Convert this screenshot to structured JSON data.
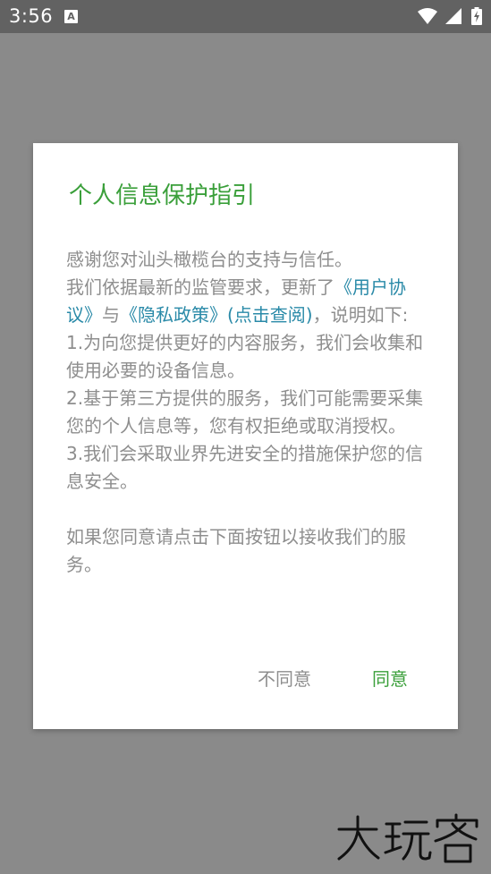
{
  "status_bar": {
    "time": "3:56",
    "icons": [
      "keyboard-a-icon",
      "wifi-icon",
      "signal-icon",
      "battery-charging-icon"
    ]
  },
  "dialog": {
    "title": "个人信息保护指引",
    "intro": "感谢您对汕头橄榄台的支持与信任。",
    "update_prefix": "我们依据最新的监管要求，更新了",
    "user_agreement": "《用户协议》",
    "and_text": "与",
    "privacy_policy": "《隐私政策》",
    "view_link": "(点击查阅)",
    "update_suffix": "，说明如下:",
    "item1": "1.为向您提供更好的内容服务，我们会收集和使用必要的设备信息。",
    "item2": "2.基于第三方提供的服务，我们可能需要采集您的个人信息等，您有权拒绝或取消授权。",
    "item3": "3.我们会采取业界先进安全的措施保护您的信息安全。",
    "closing": "如果您同意请点击下面按钮以接收我们的服务。",
    "disagree_label": "不同意",
    "agree_label": "同意"
  },
  "colors": {
    "accent_green": "#3a9f3a",
    "link_blue": "#2a8aa8",
    "body_gray": "#8e8e8e",
    "overlay": "#8a8a8a",
    "status_bar": "#626262"
  },
  "watermark": "大玩客"
}
